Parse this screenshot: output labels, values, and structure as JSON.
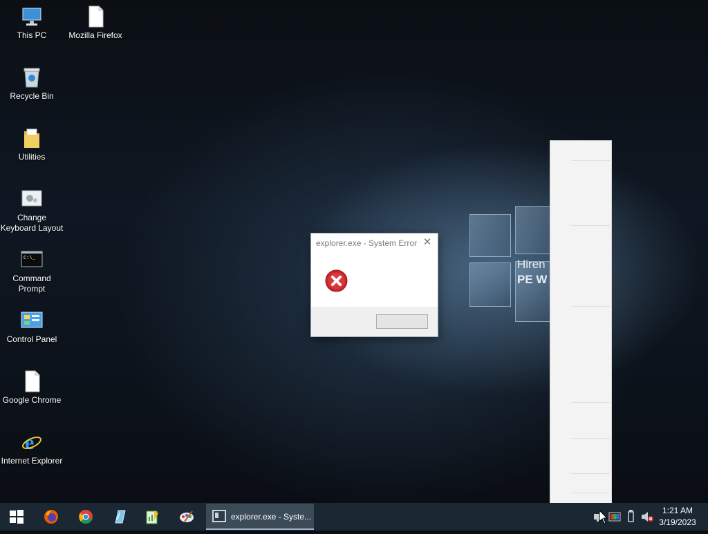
{
  "desktop": {
    "icons": [
      {
        "label": "This PC",
        "icon": "computer-icon"
      },
      {
        "label": "Mozilla Firefox",
        "icon": "blank-document-icon"
      },
      {
        "label": "Recycle Bin",
        "icon": "recycle-bin-icon"
      },
      {
        "label": "Utilities",
        "icon": "folder-icon"
      },
      {
        "label": "Change Keyboard Layout",
        "icon": "keyboard-settings-icon"
      },
      {
        "label": "Command Prompt",
        "icon": "command-prompt-icon"
      },
      {
        "label": "Control Panel",
        "icon": "control-panel-icon"
      },
      {
        "label": "Google Chrome",
        "icon": "blank-document-icon"
      },
      {
        "label": "Internet Explorer",
        "icon": "internet-explorer-icon"
      }
    ],
    "wallpaper_text": {
      "line1": "Hiren",
      "line2": "PE W"
    }
  },
  "dialog": {
    "title": "explorer.exe - System Error",
    "close_glyph": "✕",
    "icon": "error-icon",
    "ok_label": ""
  },
  "taskbar": {
    "pinned": [
      "start-button",
      "firefox-icon",
      "chrome-icon",
      "tools-icon",
      "notepad-icon",
      "paint-icon"
    ],
    "active_task": {
      "label": "explorer.exe - Syste..."
    },
    "clock": {
      "time": "1:21 AM",
      "date": "3/19/2023"
    }
  },
  "colors": {
    "taskbar": "#1b2733",
    "error_red": "#c8262b",
    "dialog_footer": "#f0f0f0"
  }
}
